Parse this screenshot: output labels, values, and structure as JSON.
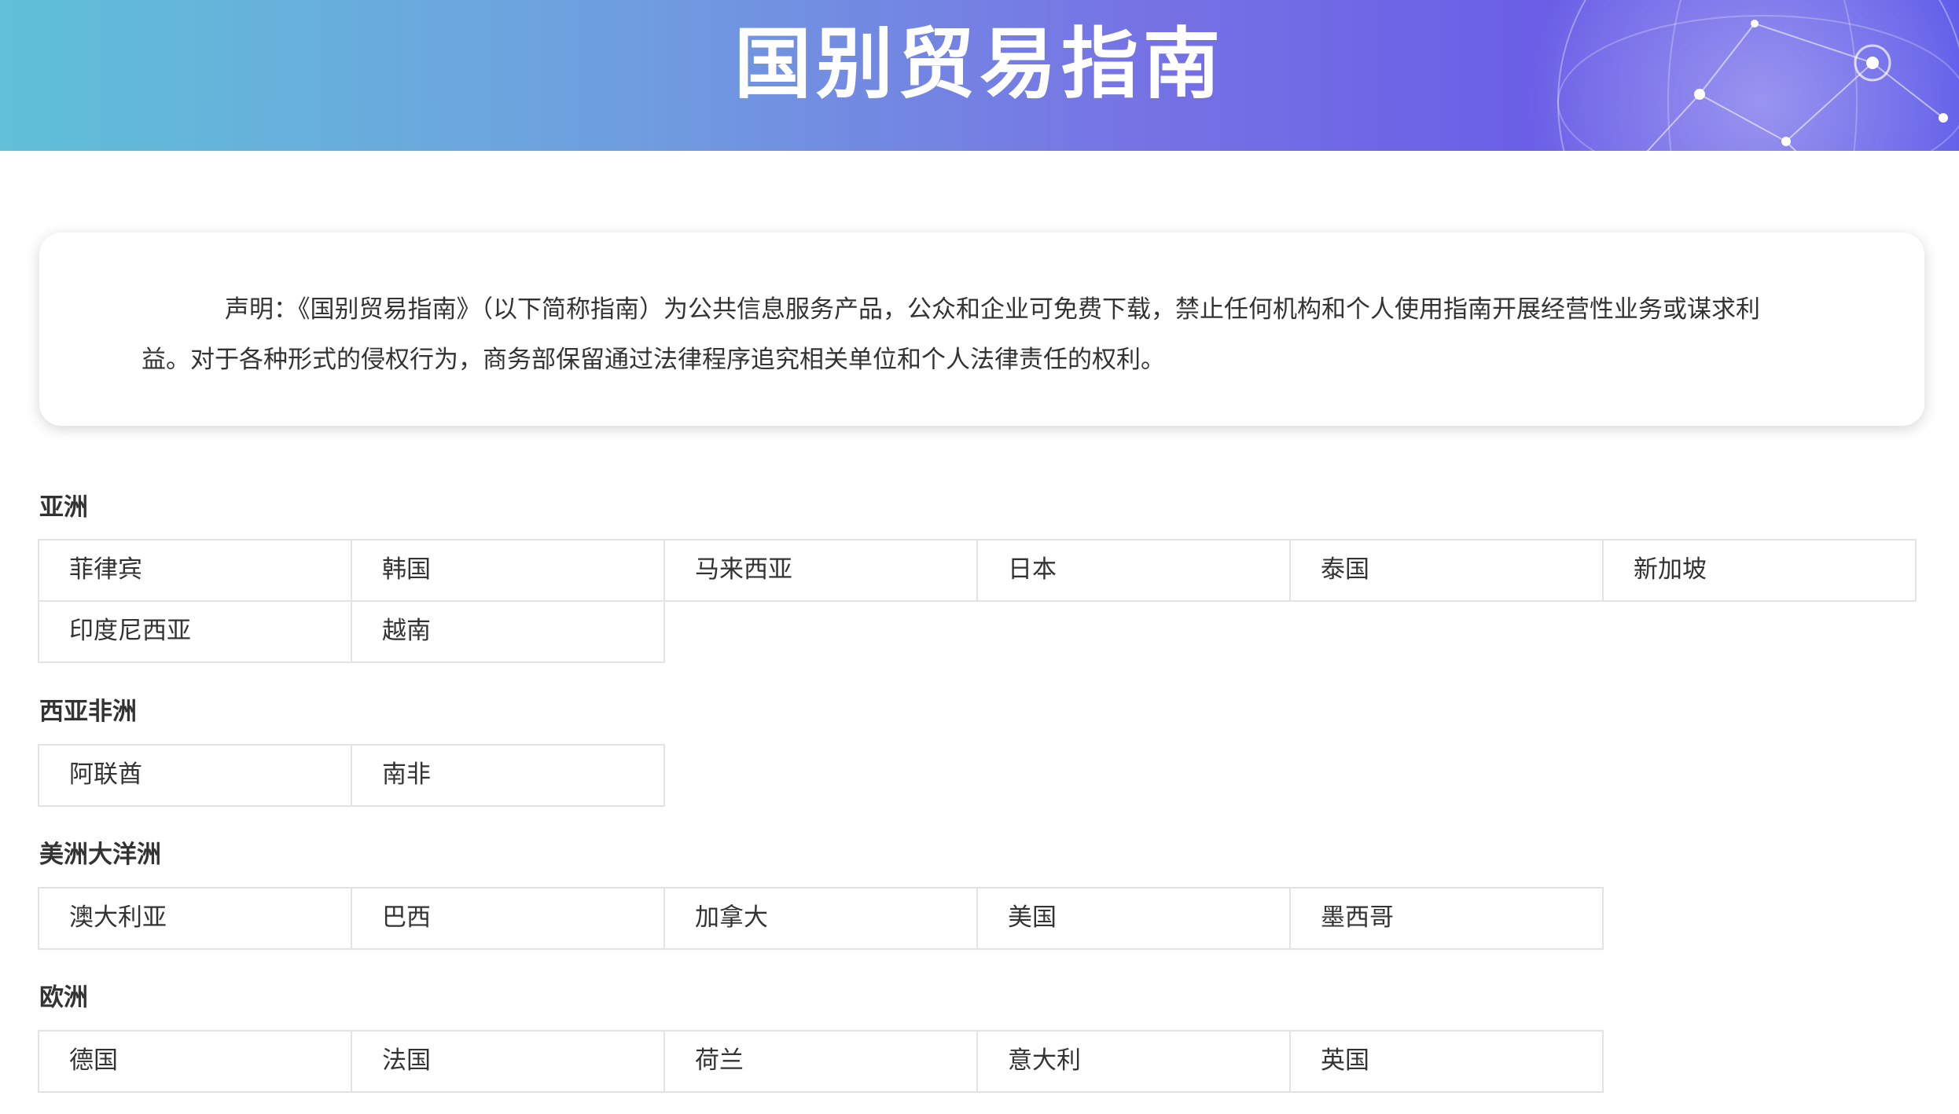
{
  "banner": {
    "title": "国别贸易指南"
  },
  "notice": {
    "text": "声明：《国别贸易指南》（以下简称指南）为公共信息服务产品，公众和企业可免费下载，禁止任何机构和个人使用指南开展经营性业务或谋求利益。对于各种形式的侵权行为，商务部保留通过法律程序追究相关单位和个人法律责任的权利。"
  },
  "regions": [
    {
      "title": "亚洲",
      "countries": [
        "菲律宾",
        "韩国",
        "马来西亚",
        "日本",
        "泰国",
        "新加坡",
        "印度尼西亚",
        "越南"
      ]
    },
    {
      "title": "西亚非洲",
      "countries": [
        "阿联酋",
        "南非"
      ]
    },
    {
      "title": "美洲大洋洲",
      "countries": [
        "澳大利亚",
        "巴西",
        "加拿大",
        "美国",
        "墨西哥"
      ]
    },
    {
      "title": "欧洲",
      "countries": [
        "德国",
        "法国",
        "荷兰",
        "意大利",
        "英国"
      ]
    }
  ],
  "colors": {
    "banner_gradient_start": "#5fc0d8",
    "banner_gradient_end": "#5b58e8",
    "cell_border": "#e3e3e3",
    "text": "#333333"
  }
}
